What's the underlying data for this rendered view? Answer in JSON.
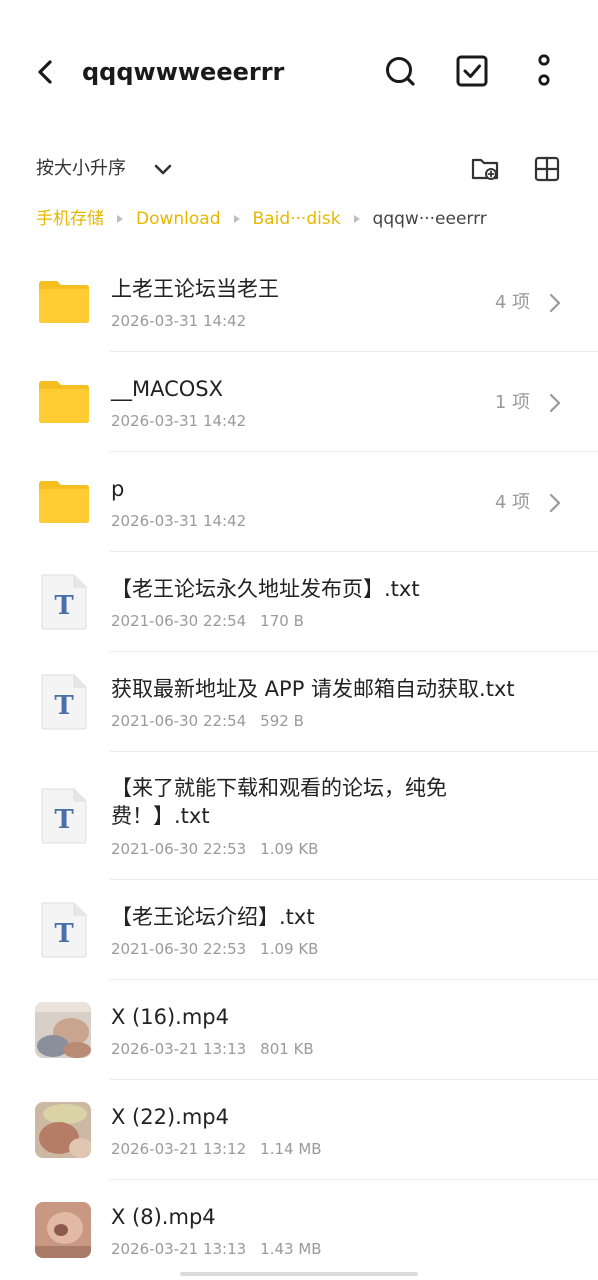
{
  "header": {
    "title": "qqqwwweeerrr",
    "icons": {
      "back": "back-arrow-icon",
      "search": "search-icon",
      "select": "select-checkbox-icon",
      "more": "more-vertical-icon"
    }
  },
  "sortbar": {
    "sort_label": "按大小升序",
    "icons": {
      "sort_dropdown": "chevron-down-icon",
      "new_folder": "new-folder-icon",
      "view": "grid-view-icon"
    }
  },
  "breadcrumb": [
    {
      "label": "手机存储"
    },
    {
      "label": "Download"
    },
    {
      "label": "Baid···disk"
    },
    {
      "label": "qqqw···eeerrr"
    }
  ],
  "colors": {
    "accent": "#e6b800",
    "folder": "#ffcc33",
    "folder_tab": "#f5bf22",
    "text_secondary": "#9a9a9a"
  },
  "files": [
    {
      "type": "folder",
      "name": "上老王论坛当老王",
      "date": "2026-03-31 14:42",
      "count": "4 项"
    },
    {
      "type": "folder",
      "name": "__MACOSX",
      "date": "2026-03-31 14:42",
      "count": "1 项"
    },
    {
      "type": "folder",
      "name": "p",
      "date": "2026-03-31 14:42",
      "count": "4 项"
    },
    {
      "type": "text",
      "name": "【老王论坛永久地址发布页】.txt",
      "date": "2021-06-30 22:54",
      "size": "170 B"
    },
    {
      "type": "text",
      "name": "获取最新地址及 APP 请发邮箱自动获取.txt",
      "date": "2021-06-30 22:54",
      "size": "592 B"
    },
    {
      "type": "text",
      "name": "【来了就能下载和观看的论坛，纯免费！】.txt",
      "date": "2021-06-30 22:53",
      "size": "1.09 KB"
    },
    {
      "type": "text",
      "name": "【老王论坛介绍】.txt",
      "date": "2021-06-30 22:53",
      "size": "1.09 KB"
    },
    {
      "type": "video",
      "name": "X (16).mp4",
      "date": "2026-03-21 13:13",
      "size": "801 KB"
    },
    {
      "type": "video",
      "name": "X (22).mp4",
      "date": "2026-03-21 13:12",
      "size": "1.14 MB"
    },
    {
      "type": "video",
      "name": "X (8).mp4",
      "date": "2026-03-21 13:13",
      "size": "1.43 MB"
    }
  ]
}
